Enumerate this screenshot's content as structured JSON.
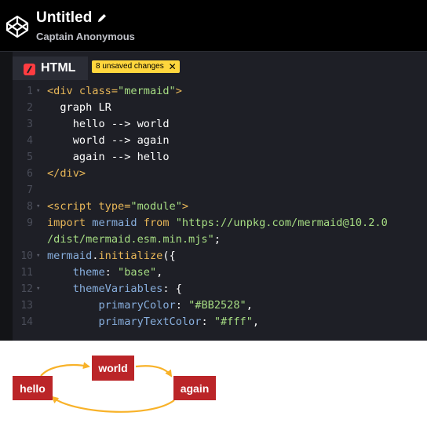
{
  "header": {
    "title": "Untitled",
    "author": "Captain Anonymous"
  },
  "editor": {
    "tab_label": "HTML",
    "badge": "8 unsaved changes",
    "badge_close": "✕",
    "lines": [
      {
        "n": "1",
        "fold": "▾",
        "segs": [
          [
            "t-tag",
            "<div "
          ],
          [
            "t-attr",
            "class="
          ],
          [
            "t-str",
            "\"mermaid\""
          ],
          [
            "t-tag",
            ">"
          ]
        ]
      },
      {
        "n": "2",
        "fold": "",
        "segs": [
          [
            "t-pl",
            "  graph LR"
          ]
        ]
      },
      {
        "n": "3",
        "fold": "",
        "segs": [
          [
            "t-pl",
            "    hello --> world"
          ]
        ]
      },
      {
        "n": "4",
        "fold": "",
        "segs": [
          [
            "t-pl",
            "    world --> again"
          ]
        ]
      },
      {
        "n": "5",
        "fold": "",
        "segs": [
          [
            "t-pl",
            "    again --> hello"
          ]
        ]
      },
      {
        "n": "6",
        "fold": "",
        "segs": [
          [
            "t-tag",
            "</div>"
          ]
        ]
      },
      {
        "n": "7",
        "fold": "",
        "segs": []
      },
      {
        "n": "8",
        "fold": "▾",
        "segs": [
          [
            "t-tag",
            "<script "
          ],
          [
            "t-attr",
            "type="
          ],
          [
            "t-str",
            "\"module\""
          ],
          [
            "t-tag",
            ">"
          ]
        ]
      },
      {
        "n": "9",
        "fold": "",
        "segs": [
          [
            "t-kw",
            "import "
          ],
          [
            "t-id",
            "mermaid "
          ],
          [
            "t-kw",
            "from "
          ],
          [
            "t-str",
            "\"https://unpkg.com/mermaid@10.2.0"
          ]
        ]
      },
      {
        "n": "",
        "fold": "",
        "segs": [
          [
            "t-str",
            "/dist/mermaid.esm.min.mjs\""
          ],
          [
            "t-pl",
            ";"
          ]
        ]
      },
      {
        "n": "10",
        "fold": "▾",
        "segs": [
          [
            "t-id",
            "mermaid"
          ],
          [
            "t-pl",
            "."
          ],
          [
            "t-kw",
            "initialize"
          ],
          [
            "t-pl",
            "({"
          ]
        ]
      },
      {
        "n": "11",
        "fold": "",
        "segs": [
          [
            "t-pl",
            "    "
          ],
          [
            "t-id",
            "theme"
          ],
          [
            "t-pl",
            ": "
          ],
          [
            "t-str",
            "\"base\""
          ],
          [
            "t-pl",
            ","
          ]
        ]
      },
      {
        "n": "12",
        "fold": "▾",
        "segs": [
          [
            "t-pl",
            "    "
          ],
          [
            "t-id",
            "themeVariables"
          ],
          [
            "t-pl",
            ": {"
          ]
        ]
      },
      {
        "n": "13",
        "fold": "",
        "segs": [
          [
            "t-pl",
            "        "
          ],
          [
            "t-id",
            "primaryColor"
          ],
          [
            "t-pl",
            ": "
          ],
          [
            "t-str",
            "\"#BB2528\""
          ],
          [
            "t-pl",
            ","
          ]
        ]
      },
      {
        "n": "14",
        "fold": "",
        "segs": [
          [
            "t-pl",
            "        "
          ],
          [
            "t-id",
            "primaryTextColor"
          ],
          [
            "t-pl",
            ": "
          ],
          [
            "t-str",
            "\"#fff\""
          ],
          [
            "t-pl",
            ","
          ]
        ]
      }
    ]
  },
  "diagram": {
    "node_fill": "#BB2528",
    "edge_color": "#F8B229",
    "nodes": {
      "hello": "hello",
      "world": "world",
      "again": "again"
    }
  }
}
